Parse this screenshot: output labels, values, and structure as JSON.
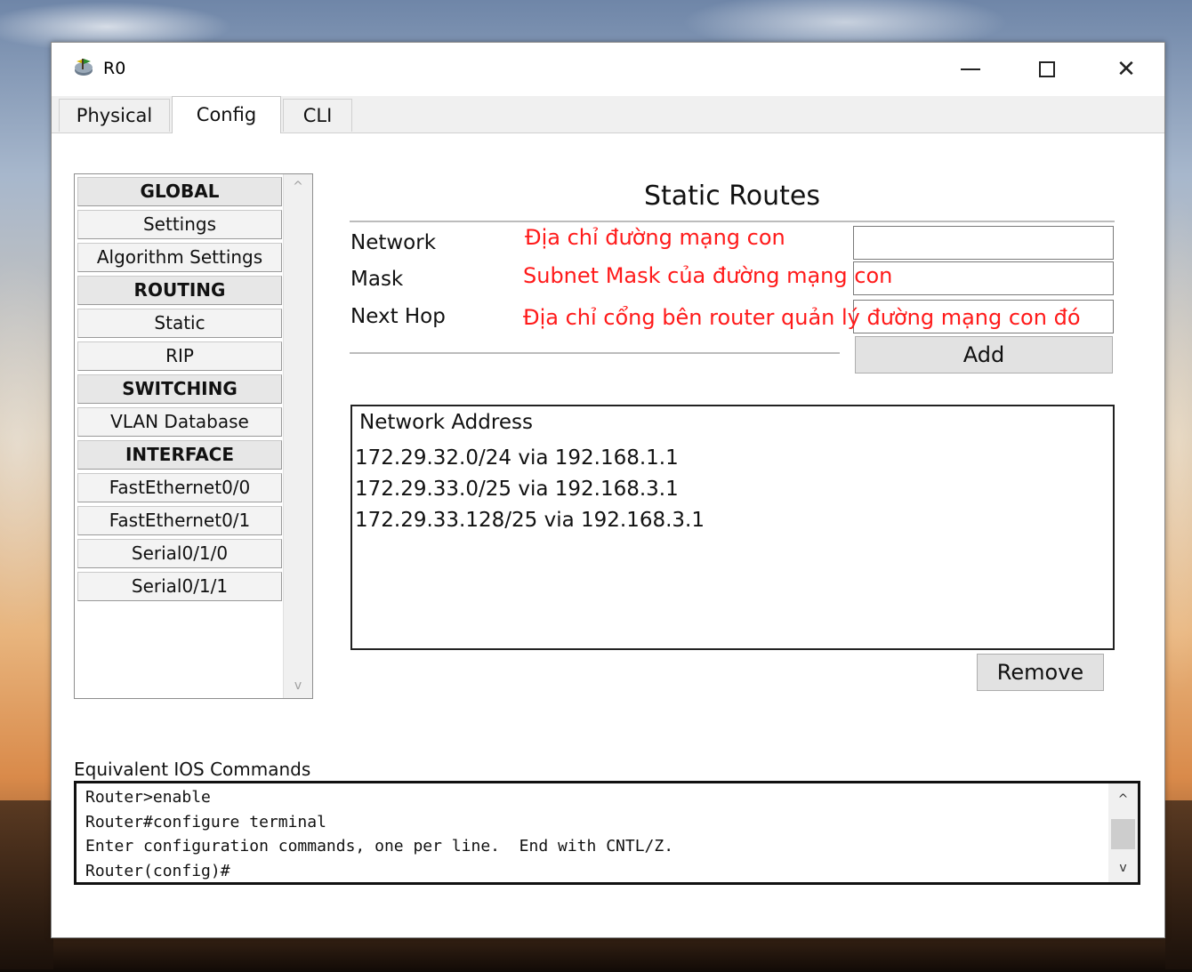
{
  "window": {
    "title": "R0",
    "minimize_glyph": "",
    "close_glyph": "✕"
  },
  "tabs": [
    {
      "label": "Physical"
    },
    {
      "label": "Config"
    },
    {
      "label": "CLI"
    }
  ],
  "sidebar": {
    "items": [
      {
        "label": "GLOBAL",
        "header": true
      },
      {
        "label": "Settings"
      },
      {
        "label": "Algorithm Settings"
      },
      {
        "label": "ROUTING",
        "header": true
      },
      {
        "label": "Static"
      },
      {
        "label": "RIP"
      },
      {
        "label": "SWITCHING",
        "header": true
      },
      {
        "label": "VLAN Database"
      },
      {
        "label": "INTERFACE",
        "header": true
      },
      {
        "label": "FastEthernet0/0"
      },
      {
        "label": "FastEthernet0/1"
      },
      {
        "label": "Serial0/1/0"
      },
      {
        "label": "Serial0/1/1"
      }
    ],
    "scroll_up_glyph": "^",
    "scroll_down_glyph": "v"
  },
  "static_routes": {
    "title": "Static Routes",
    "network_label": "Network",
    "mask_label": "Mask",
    "next_hop_label": "Next Hop",
    "network_value": "",
    "mask_value": "",
    "next_hop_value": "",
    "network_note": "Địa chỉ đường mạng con",
    "mask_note": "Subnet Mask của đường mạng con",
    "next_hop_note": "Địa chỉ cổng bên router quản lý đường mạng con đó",
    "add_label": "Add",
    "list_header": "Network Address",
    "routes": [
      "172.29.32.0/24 via 192.168.1.1",
      "172.29.33.0/25 via 192.168.3.1",
      "172.29.33.128/25 via 192.168.3.1"
    ],
    "remove_label": "Remove"
  },
  "ios": {
    "label": "Equivalent IOS Commands",
    "lines": [
      "Router>enable",
      "Router#configure terminal",
      "Enter configuration commands, one per line.  End with CNTL/Z.",
      "Router(config)#"
    ],
    "scroll_up_glyph": "^",
    "scroll_down_glyph": "v"
  },
  "colors": {
    "note_red": "#ff1a1a"
  }
}
